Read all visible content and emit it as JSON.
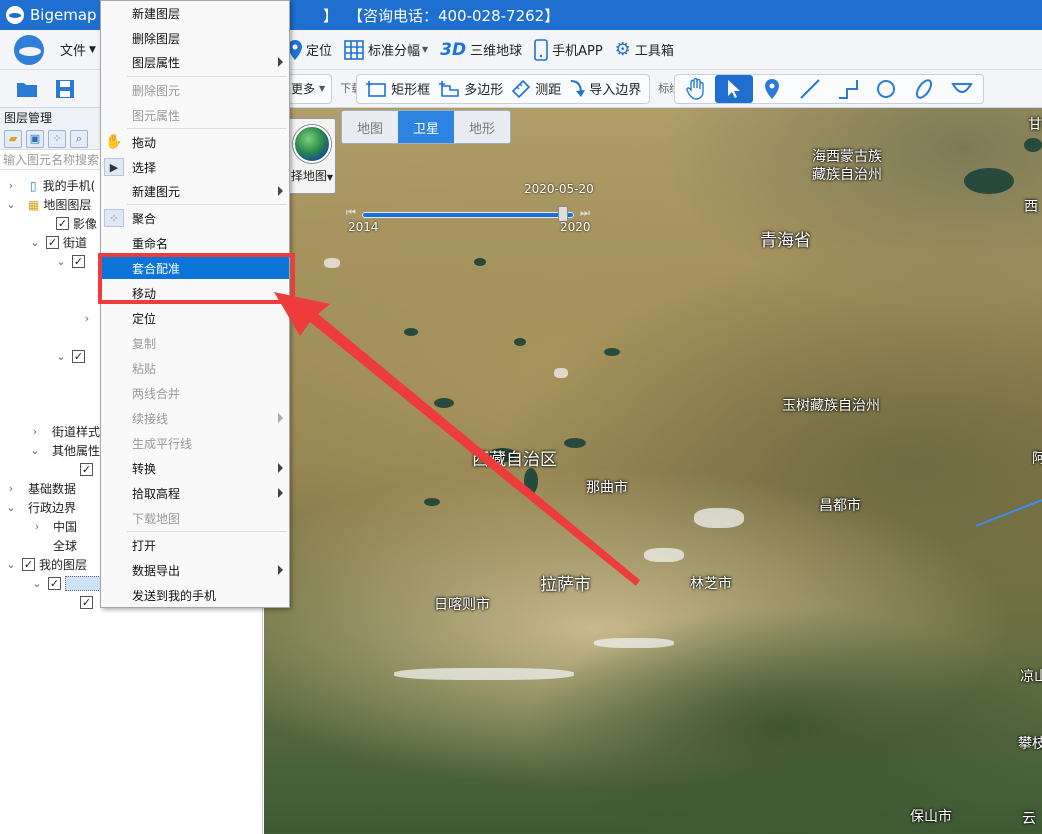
{
  "titlebar": {
    "app_name": "Bigemap G",
    "bracket": "】",
    "contact": "【咨询电话：400-028-7262】"
  },
  "toolbar1": {
    "file": "文件",
    "locate": "定位",
    "grid": "标准分幅",
    "threeD_icon": "3D",
    "globe": "三维地球",
    "phone_app": "手机APP",
    "toolbox": "工具箱"
  },
  "toolbar2": {
    "more": "更多",
    "download": "下载",
    "rect": "矩形框",
    "polygon": "多边形",
    "measure": "测距",
    "import_border": "导入边界",
    "annotate": "标绘"
  },
  "left_panel": {
    "title": "图层管理",
    "search_placeholder": "输入图元名称搜索",
    "tree": {
      "my_phone": "我的手机(",
      "map_layers": "地图图层",
      "imagery": "影像",
      "street": "街道",
      "street_style": "街道样式",
      "other_props": "其他属性",
      "base_data": "基础数据",
      "admin_border": "行政边界",
      "china": "中国",
      "world": "全球",
      "my_layers": "我的图层"
    }
  },
  "context_menu": {
    "items": [
      {
        "label": "新建图层"
      },
      {
        "label": "删除图层"
      },
      {
        "label": "图层属性"
      },
      {
        "label": "删除图元"
      },
      {
        "label": "图元属性"
      },
      {
        "label": "拖动"
      },
      {
        "label": "选择"
      },
      {
        "label": "新建图元"
      },
      {
        "label": "聚合"
      },
      {
        "label": "重命名"
      },
      {
        "label": "套合配准"
      },
      {
        "label": "移动"
      },
      {
        "label": "定位"
      },
      {
        "label": "复制"
      },
      {
        "label": "粘贴"
      },
      {
        "label": "两线合并"
      },
      {
        "label": "续接线"
      },
      {
        "label": "生成平行线"
      },
      {
        "label": "转换"
      },
      {
        "label": "拾取高程"
      },
      {
        "label": "下载地图"
      },
      {
        "label": "打开"
      },
      {
        "label": "数据导出"
      },
      {
        "label": "发送到我的手机"
      }
    ]
  },
  "map": {
    "tabs": {
      "map": "地图",
      "satellite": "卫星",
      "terrain": "地形"
    },
    "chooser_label": "择地图",
    "timeline": {
      "current_date": "2020-05-20",
      "start_year": "2014",
      "end_year": "2020",
      "position": 0.95
    },
    "places": {
      "qinghai": "青海省",
      "haixi": "海西蒙古族\n藏族自治州",
      "yushu": "玉树藏族自治州",
      "tibet": "西藏自治区",
      "nagqu": "那曲市",
      "qamdo": "昌都市",
      "lhasa": "拉萨市",
      "nyingchi": "林芝市",
      "shigatse": "日喀则市",
      "baoshan": "保山市",
      "liangshan": "凉山",
      "panzhi": "攀枝",
      "gan": "甘",
      "xi": "西",
      "a": "阿",
      "yun": "云"
    }
  },
  "colors": {
    "titlebar": "#1e6fd0",
    "menu_highlight": "#0a74d9",
    "annotation": "#ee3b3b"
  }
}
